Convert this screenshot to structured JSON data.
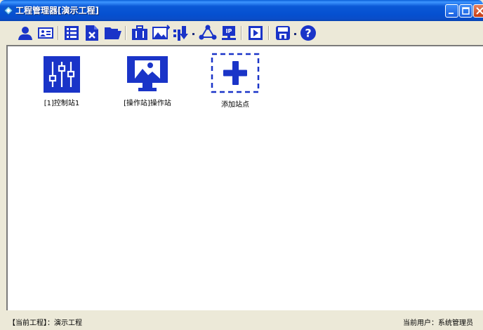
{
  "window": {
    "title": "工程管理器[演示工程]"
  },
  "toolbar": {
    "buttons": [
      {
        "icon": "user-icon"
      },
      {
        "icon": "id-card-icon"
      },
      {
        "icon": "list-icon"
      },
      {
        "icon": "delete-file-icon"
      },
      {
        "icon": "open-folder-icon"
      },
      {
        "icon": "briefcase-icon"
      },
      {
        "icon": "image-transfer-icon"
      },
      {
        "icon": "download-list-icon"
      },
      {
        "icon": "network-icon"
      },
      {
        "icon": "ip-settings-icon"
      },
      {
        "icon": "play-icon"
      },
      {
        "icon": "save-icon"
      },
      {
        "icon": "help-icon"
      }
    ]
  },
  "stations": [
    {
      "label": "[1]控制站1",
      "icon": "mixer-sliders-icon",
      "kind": "control"
    },
    {
      "label": "[操作站]操作站",
      "icon": "monitor-icon",
      "kind": "operator"
    },
    {
      "label": "添加站点",
      "icon": "add-plus-icon",
      "kind": "add"
    }
  ],
  "statusbar": {
    "project": "【当前工程】：演示工程",
    "user": "当前用户：系统管理员"
  },
  "colors": {
    "accent": "#1a34c8",
    "titlebar": "#0550d0",
    "background": "#ece9d8"
  }
}
